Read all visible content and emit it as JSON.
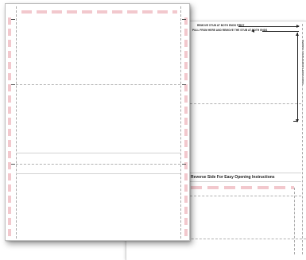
{
  "colors": {
    "pin_strip": "#f2c8cd",
    "perforation": "#a8a8a8",
    "ink": "#222222",
    "paper": "#ffffff"
  },
  "back_sheet": {
    "instruction_line_1": "REMOVE STUB AT BOTH ENDS FIRST",
    "instruction_line_2": "PULL FROM HERE AND REMOVE THE STUB AT BOTH ENDS",
    "side_instruction": "REMOVE STUB AT BOTH ENDS FIRST",
    "reverse_note": "Reverse Side For Easy Opening Instructions"
  }
}
